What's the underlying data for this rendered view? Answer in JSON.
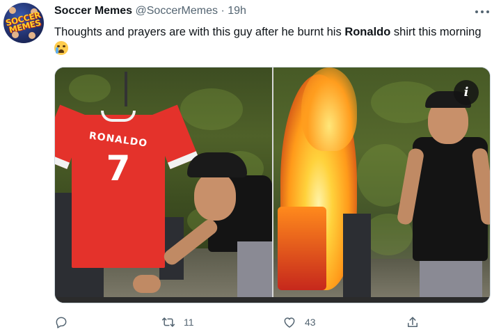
{
  "author": {
    "name": "Soccer Memes",
    "handle": "@SoccerMemes",
    "separator": "·",
    "time": "19h",
    "avatar_logo_text": "SOCCER MEMES"
  },
  "more_icon": "more-horizontal-icon",
  "tweet": {
    "text_before": "Thoughts and prayers are with this guy after he burnt his ",
    "text_bold": "Ronaldo",
    "text_after": " shirt this morning",
    "emoji": "loudly-crying-face-emoji"
  },
  "media": {
    "shirt_name": "RONALDO",
    "shirt_number": "7",
    "info_button_label": "i"
  },
  "actions": {
    "reply": {
      "icon": "reply-icon",
      "count": ""
    },
    "retweet": {
      "icon": "retweet-icon",
      "count": "11"
    },
    "like": {
      "icon": "heart-icon",
      "count": "43"
    },
    "share": {
      "icon": "share-icon",
      "count": ""
    }
  },
  "colors": {
    "text_primary": "#0f1419",
    "text_secondary": "#536471",
    "shirt_red": "#e4322b"
  }
}
